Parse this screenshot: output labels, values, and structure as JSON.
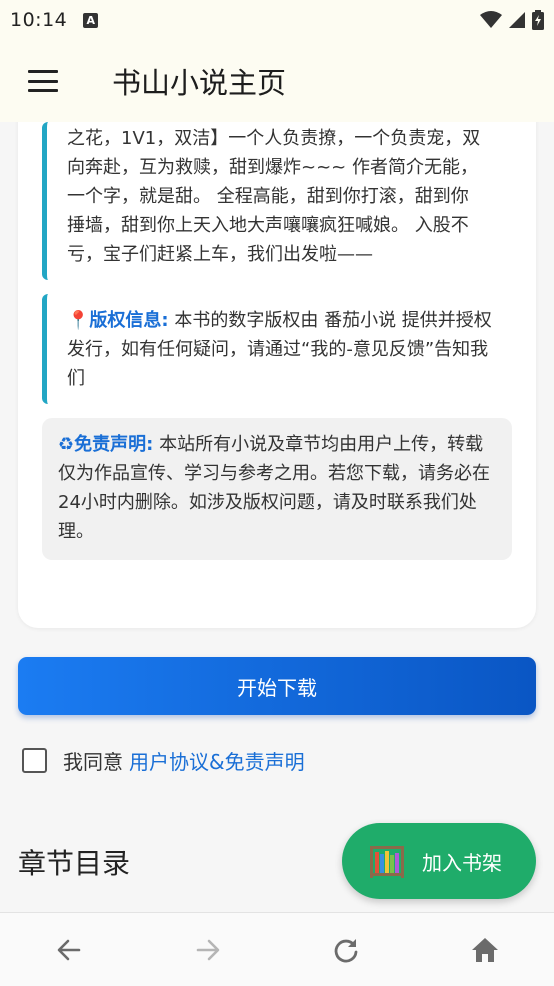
{
  "status": {
    "time": "10:14",
    "a_badge": "A"
  },
  "appbar": {
    "title": "书山小说主页"
  },
  "book": {
    "intro_lines": [
      "之花，1V1，双洁】一个人负责撩，一个负责宠，双",
      "向奔赴，互为救赎，甜到爆炸~~~ 作者简介无能，",
      "一个字，就是甜。 全程高能，甜到你打滚，甜到你",
      "捶墙，甜到你上天入地大声嚷嚷疯狂喊娘。 入股不",
      "亏，宝子们赶紧上车，我们出发啦——"
    ],
    "copyright_icon": "📍",
    "copyright_label": "版权信息:",
    "copyright_text": " 本书的数字版权由 番茄小说 提供并授权发行，如有任何疑问，请通过“我的-意见反馈”告知我们",
    "disclaimer_icon": "♻",
    "disclaimer_label": "免责声明:",
    "disclaimer_text": " 本站所有小说及章节均由用户上传，转载仅为作品宣传、学习与参考之用。若您下载，请务必在24小时内删除。如涉及版权问题，请及时联系我们处理。"
  },
  "download_button": "开始下载",
  "agreement": {
    "prefix": "我同意",
    "link": "用户协议&免责声明",
    "checked": false
  },
  "chapters_title": "章节目录",
  "fab": {
    "label": "加入书架",
    "icon": "bookshelf-icon"
  },
  "nav": [
    "back-icon",
    "forward-icon",
    "refresh-icon",
    "home-icon"
  ],
  "colors": {
    "accent_blue": "#1a6fd6",
    "quote_border": "#22a6c4",
    "fab_green": "#1fac6a",
    "appbar_bg": "#fdfcf2"
  }
}
